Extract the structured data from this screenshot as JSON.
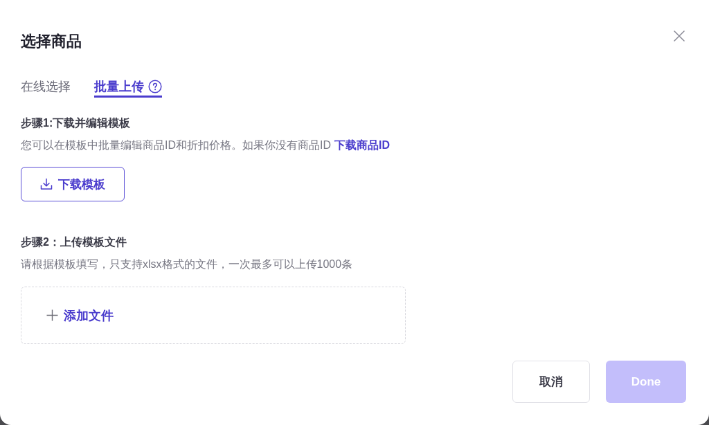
{
  "dialog": {
    "title": "选择商品"
  },
  "tabs": [
    {
      "label": "在线选择",
      "selected": false,
      "kind": "plain"
    },
    {
      "label": "批量上传",
      "selected": true,
      "kind": "help"
    }
  ],
  "steps": [
    {
      "title": "步骤1:下载并编辑模板",
      "description": "您可以在模板中批量编辑商品ID和折扣价格。如果你没有商品ID",
      "link": "下载商品ID",
      "action": {
        "kind": "download",
        "label": "下载模板"
      }
    },
    {
      "title": "步骤2：上传模板文件",
      "description": "请根据模板填写，只支持xlsx格式的文件，一次最多可以上传1000条",
      "action": {
        "kind": "upload",
        "label": "添加文件"
      }
    }
  ],
  "buttons": [
    {
      "label": "取消",
      "kind": "secondary",
      "disabled": false
    },
    {
      "label": "Done",
      "kind": "primary",
      "disabled": true
    }
  ]
}
